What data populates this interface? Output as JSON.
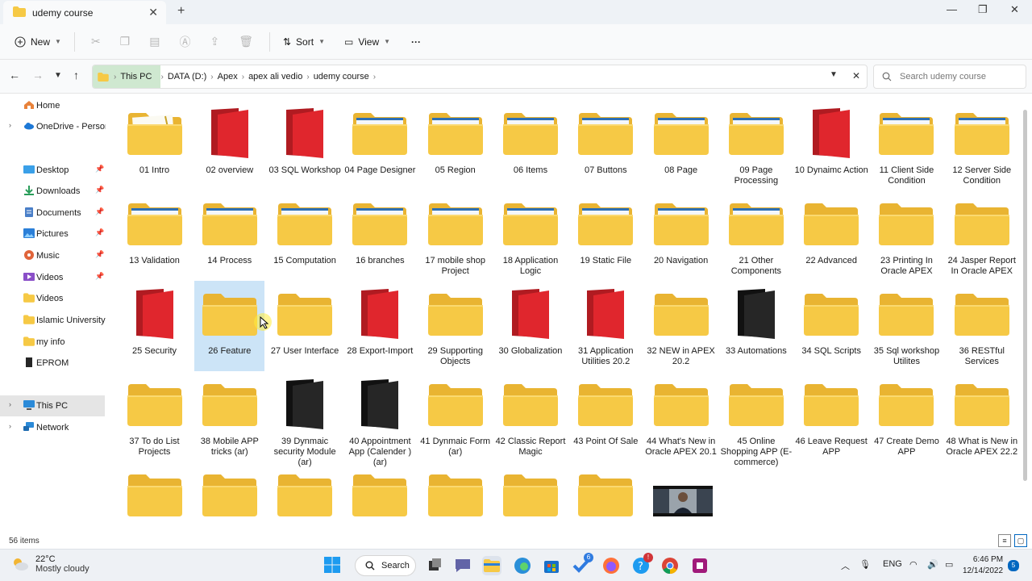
{
  "window": {
    "tab_title": "udemy course",
    "tab_close": "✕",
    "new_tab": "+",
    "minimize": "—",
    "maximize": "❐",
    "close": "✕"
  },
  "toolbar": {
    "new_label": "New",
    "sort_label": "Sort",
    "view_label": "View",
    "more": "···"
  },
  "address": {
    "crumbs": [
      "This PC",
      "DATA (D:)",
      "Apex",
      "apex ali vedio",
      "udemy course"
    ],
    "search_placeholder": "Search udemy course"
  },
  "sidebar": {
    "items": [
      {
        "label": "Home"
      },
      {
        "label": "OneDrive - Persona"
      },
      {
        "label": "Desktop"
      },
      {
        "label": "Downloads"
      },
      {
        "label": "Documents"
      },
      {
        "label": "Pictures"
      },
      {
        "label": "Music"
      },
      {
        "label": "Videos"
      },
      {
        "label": "Videos"
      },
      {
        "label": "Islamic University o"
      },
      {
        "label": "my info"
      },
      {
        "label": "EPROM"
      },
      {
        "label": "This PC"
      },
      {
        "label": "Network"
      }
    ]
  },
  "files": [
    {
      "name": "01 Intro",
      "style": "yellow-doc"
    },
    {
      "name": "02 overview",
      "style": "red"
    },
    {
      "name": "03 SQL Workshop",
      "style": "red"
    },
    {
      "name": "04 Page Designer",
      "style": "yellow-preview"
    },
    {
      "name": "05 Region",
      "style": "yellow-preview"
    },
    {
      "name": "06 Items",
      "style": "yellow-preview"
    },
    {
      "name": "07 Buttons",
      "style": "yellow-preview"
    },
    {
      "name": "08 Page",
      "style": "yellow-preview"
    },
    {
      "name": "09 Page Processing",
      "style": "yellow-preview"
    },
    {
      "name": "10 Dynaimc Action",
      "style": "red"
    },
    {
      "name": "11 Client Side Condition",
      "style": "yellow-preview"
    },
    {
      "name": "12 Server Side Condition",
      "style": "yellow-preview"
    },
    {
      "name": "13 Validation",
      "style": "yellow-preview"
    },
    {
      "name": "14 Process",
      "style": "yellow-preview"
    },
    {
      "name": "15 Computation",
      "style": "yellow-preview"
    },
    {
      "name": "16 branches",
      "style": "yellow-preview"
    },
    {
      "name": "17 mobile shop Project",
      "style": "yellow-preview"
    },
    {
      "name": "18 Application Logic",
      "style": "yellow-preview"
    },
    {
      "name": "19 Static File",
      "style": "yellow-preview"
    },
    {
      "name": "20 Navigation",
      "style": "yellow-preview"
    },
    {
      "name": "21 Other Components",
      "style": "yellow-preview"
    },
    {
      "name": "22 Advanced",
      "style": "yellow"
    },
    {
      "name": "23 Printing In Oracle APEX",
      "style": "yellow"
    },
    {
      "name": "24 Jasper Report In Oracle APEX",
      "style": "yellow"
    },
    {
      "name": "25 Security",
      "style": "red"
    },
    {
      "name": "26 Feature",
      "style": "yellow",
      "selected": true
    },
    {
      "name": "27 User Interface",
      "style": "yellow"
    },
    {
      "name": "28 Export-Import",
      "style": "red"
    },
    {
      "name": "29 Supporting Objects",
      "style": "yellow"
    },
    {
      "name": "30 Globalization",
      "style": "red"
    },
    {
      "name": "31 Application Utilities 20.2",
      "style": "red"
    },
    {
      "name": "32 NEW in APEX 20.2",
      "style": "yellow"
    },
    {
      "name": "33 Automations",
      "style": "black"
    },
    {
      "name": "34 SQL Scripts",
      "style": "yellow"
    },
    {
      "name": "35 Sql workshop Utilites",
      "style": "yellow"
    },
    {
      "name": "36 RESTful Services",
      "style": "yellow"
    },
    {
      "name": "37 To do List Projects",
      "style": "yellow"
    },
    {
      "name": "38 Mobile APP tricks (ar)",
      "style": "yellow"
    },
    {
      "name": "39 Dynmaic security Module (ar)",
      "style": "black"
    },
    {
      "name": "40 Appointment App (Calender ) (ar)",
      "style": "black"
    },
    {
      "name": "41 Dynmaic Form (ar)",
      "style": "yellow"
    },
    {
      "name": "42 Classic Report Magic",
      "style": "yellow"
    },
    {
      "name": "43 Point Of Sale",
      "style": "yellow"
    },
    {
      "name": "44 What's New in Oracle APEX 20.1",
      "style": "yellow"
    },
    {
      "name": "45 Online Shopping APP (E-commerce)",
      "style": "yellow"
    },
    {
      "name": "46 Leave Request APP",
      "style": "yellow"
    },
    {
      "name": "47 Create Demo APP",
      "style": "yellow"
    },
    {
      "name": "48 What is New in Oracle APEX 22.2",
      "style": "yellow"
    },
    {
      "name": "",
      "style": "yellow"
    },
    {
      "name": "",
      "style": "yellow"
    },
    {
      "name": "",
      "style": "yellow"
    },
    {
      "name": "",
      "style": "yellow"
    },
    {
      "name": "",
      "style": "yellow"
    },
    {
      "name": "",
      "style": "yellow"
    },
    {
      "name": "",
      "style": "yellow"
    },
    {
      "name": "",
      "style": "video"
    }
  ],
  "status": {
    "count": "56 items"
  },
  "taskbar": {
    "temperature": "22°C",
    "weather": "Mostly cloudy",
    "search_label": "Search",
    "language": "ENG",
    "time": "6:46 PM",
    "date": "12/14/2022",
    "todo_badge": "6",
    "notif_badge": "5"
  },
  "colors": {
    "folder_yellow": "#f6c945",
    "folder_red": "#e0262d",
    "folder_black": "#262626",
    "selection": "#cce4f7"
  }
}
